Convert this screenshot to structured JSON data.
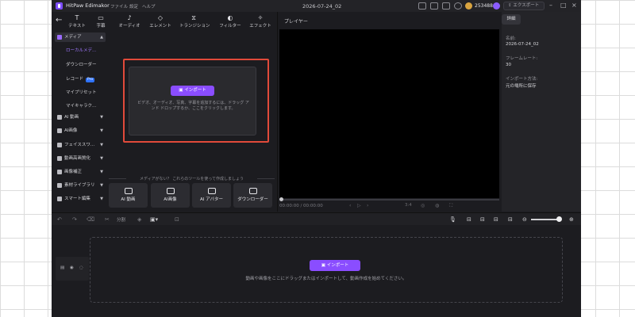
{
  "app": {
    "name": "HitPaw Edimakor",
    "menus": [
      "ファイル",
      "設定",
      "ヘルプ"
    ],
    "project_title": "2026-07-24_02",
    "coins": "253488",
    "export_label": "エクスポート",
    "accent_color": "#8a4dff"
  },
  "tools": [
    {
      "label": "テキスト",
      "icon": "text-icon"
    },
    {
      "label": "字幕",
      "icon": "subtitle-icon"
    },
    {
      "label": "オーディオ",
      "icon": "music-icon"
    },
    {
      "label": "エレメント",
      "icon": "element-icon"
    },
    {
      "label": "トランジション",
      "icon": "transition-icon"
    },
    {
      "label": "フィルター",
      "icon": "filter-icon"
    },
    {
      "label": "エフェクト",
      "icon": "effect-icon"
    }
  ],
  "sidebar": {
    "media_label": "メディア",
    "sub_items": [
      "ローカルメデ...",
      "ダウンローダー",
      "レコード",
      "マイプリセット",
      "マイキャラク..."
    ],
    "record_badge": "Pro",
    "groups": [
      "AI 動画",
      "AI画像",
      "フェイススワ...",
      "動画高画質化",
      "画像補正",
      "素材ライブラリ",
      "スマート編集"
    ]
  },
  "media": {
    "import_label": "インポート",
    "drop_hint": "ビデオ、オーディオ、写真、字幕を追加するには、ドラッグ アンド ドロップするか、ここをクリックします。",
    "suggestion": "メディアがない？ これらのツールを使って作成しましょう",
    "tool_cards": [
      "AI 動画",
      "AI画像",
      "AI アバター",
      "ダウンローダー"
    ]
  },
  "player": {
    "title": "プレイヤー",
    "time": "00:00:00 / 00:00:00",
    "ratio": "3:4"
  },
  "details": {
    "tab": "詳細",
    "name_label": "名前:",
    "name_value": "2026-07-24_02",
    "fps_label": "フレームレート:",
    "fps_value": "30",
    "method_label": "インポート方法:",
    "method_value": "元の場所に保存"
  },
  "timeline": {
    "split_label": "分割",
    "import_label": "インポート",
    "drop_hint": "動画や画像をここにドラッグまたはインポートして、動画作成を始めてください。"
  }
}
